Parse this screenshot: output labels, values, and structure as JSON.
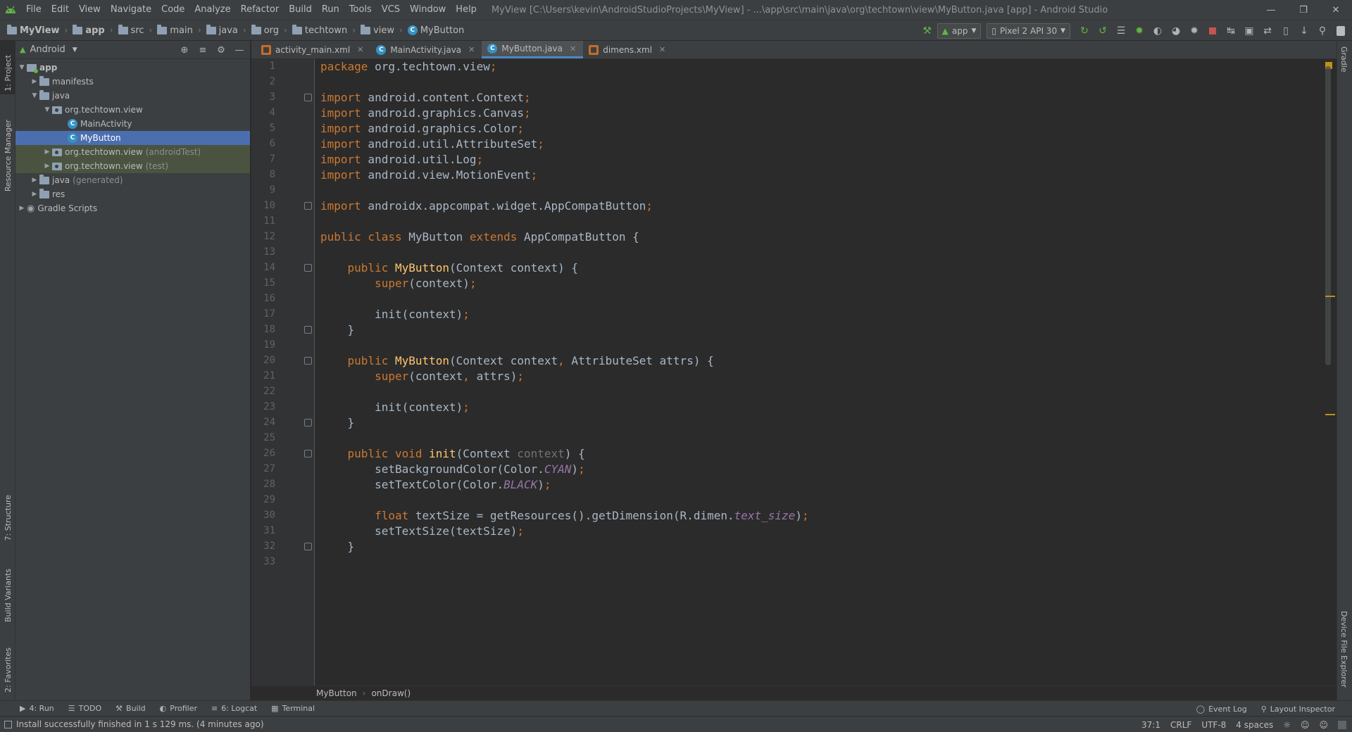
{
  "menubar": {
    "items": [
      "File",
      "Edit",
      "View",
      "Navigate",
      "Code",
      "Analyze",
      "Refactor",
      "Build",
      "Run",
      "Tools",
      "VCS",
      "Window",
      "Help"
    ],
    "window_title": "MyView [C:\\Users\\kevin\\AndroidStudioProjects\\MyView] - ...\\app\\src\\main\\java\\org\\techtown\\view\\MyButton.java [app] - Android Studio"
  },
  "navbar": {
    "crumbs": [
      "MyView",
      "app",
      "src",
      "main",
      "java",
      "org",
      "techtown",
      "view",
      "MyButton"
    ],
    "run_config": "app",
    "device": "Pixel 2 API 30"
  },
  "left_stripe": {
    "project": "1: Project",
    "resource_manager": "Resource Manager",
    "structure": "7: Structure",
    "build_variants": "Build Variants",
    "favorites": "2: Favorites"
  },
  "right_stripe": {
    "gradle": "Gradle",
    "device_file_explorer": "Device File Explorer"
  },
  "project_panel": {
    "view_mode": "Android",
    "tree": [
      {
        "label": "app",
        "suffix": ""
      },
      {
        "label": "manifests",
        "suffix": ""
      },
      {
        "label": "java",
        "suffix": ""
      },
      {
        "label": "org.techtown.view",
        "suffix": ""
      },
      {
        "label": "MainActivity",
        "suffix": ""
      },
      {
        "label": "MyButton",
        "suffix": ""
      },
      {
        "label": "org.techtown.view",
        "suffix": "(androidTest)"
      },
      {
        "label": "org.techtown.view",
        "suffix": "(test)"
      },
      {
        "label": "java",
        "suffix": "(generated)"
      },
      {
        "label": "res",
        "suffix": ""
      },
      {
        "label": "Gradle Scripts",
        "suffix": ""
      }
    ]
  },
  "editor_tabs": [
    {
      "label": "activity_main.xml",
      "type": "xml"
    },
    {
      "label": "MainActivity.java",
      "type": "class"
    },
    {
      "label": "MyButton.java",
      "type": "class",
      "active": true
    },
    {
      "label": "dimens.xml",
      "type": "xml"
    }
  ],
  "code": {
    "line_numbers": [
      "1",
      "2",
      "3",
      "4",
      "5",
      "6",
      "7",
      "8",
      "9",
      "10",
      "11",
      "12",
      "13",
      "14",
      "15",
      "16",
      "17",
      "18",
      "19",
      "20",
      "21",
      "22",
      "23",
      "24",
      "25",
      "26",
      "27",
      "28",
      "29",
      "30",
      "31",
      "32",
      "33"
    ],
    "lines": [
      [
        [
          "kw",
          "package"
        ],
        [
          "t",
          " org.techtown.view"
        ],
        [
          "kw",
          ";"
        ]
      ],
      [],
      [
        [
          "kw",
          "import"
        ],
        [
          "t",
          " android.content.Context"
        ],
        [
          "kw",
          ";"
        ]
      ],
      [
        [
          "kw",
          "import"
        ],
        [
          "t",
          " android.graphics.Canvas"
        ],
        [
          "kw",
          ";"
        ]
      ],
      [
        [
          "kw",
          "import"
        ],
        [
          "t",
          " android.graphics.Color"
        ],
        [
          "kw",
          ";"
        ]
      ],
      [
        [
          "kw",
          "import"
        ],
        [
          "t",
          " android.util.AttributeSet"
        ],
        [
          "kw",
          ";"
        ]
      ],
      [
        [
          "kw",
          "import"
        ],
        [
          "t",
          " android.util.Log"
        ],
        [
          "kw",
          ";"
        ]
      ],
      [
        [
          "kw",
          "import"
        ],
        [
          "t",
          " android.view.MotionEvent"
        ],
        [
          "kw",
          ";"
        ]
      ],
      [],
      [
        [
          "kw",
          "import"
        ],
        [
          "t",
          " androidx.appcompat.widget.AppCompatButton"
        ],
        [
          "kw",
          ";"
        ]
      ],
      [],
      [
        [
          "kw",
          "public class"
        ],
        [
          "t",
          " MyButton "
        ],
        [
          "kw",
          "extends"
        ],
        [
          "t",
          " AppCompatButton {"
        ]
      ],
      [],
      [
        [
          "t",
          "    "
        ],
        [
          "kw",
          "public"
        ],
        [
          "t",
          " "
        ],
        [
          "fn",
          "MyButton"
        ],
        [
          "t",
          "(Context context) {"
        ]
      ],
      [
        [
          "t",
          "        "
        ],
        [
          "kw",
          "super"
        ],
        [
          "t",
          "(context)"
        ],
        [
          "kw",
          ";"
        ]
      ],
      [],
      [
        [
          "t",
          "        init(context)"
        ],
        [
          "kw",
          ";"
        ]
      ],
      [
        [
          "t",
          "    }"
        ]
      ],
      [],
      [
        [
          "t",
          "    "
        ],
        [
          "kw",
          "public"
        ],
        [
          "t",
          " "
        ],
        [
          "fn",
          "MyButton"
        ],
        [
          "t",
          "(Context context"
        ],
        [
          "kw",
          ","
        ],
        [
          "t",
          " AttributeSet attrs) {"
        ]
      ],
      [
        [
          "t",
          "        "
        ],
        [
          "kw",
          "super"
        ],
        [
          "t",
          "(context"
        ],
        [
          "kw",
          ","
        ],
        [
          "t",
          " attrs)"
        ],
        [
          "kw",
          ";"
        ]
      ],
      [],
      [
        [
          "t",
          "        init(context)"
        ],
        [
          "kw",
          ";"
        ]
      ],
      [
        [
          "t",
          "    }"
        ]
      ],
      [],
      [
        [
          "t",
          "    "
        ],
        [
          "kw",
          "public void"
        ],
        [
          "t",
          " "
        ],
        [
          "fn",
          "init"
        ],
        [
          "t",
          "(Context "
        ],
        [
          "unused",
          "context"
        ],
        [
          "t",
          ") {"
        ]
      ],
      [
        [
          "t",
          "        setBackgroundColor(Color."
        ],
        [
          "cst",
          "CYAN"
        ],
        [
          "t",
          ")"
        ],
        [
          "kw",
          ";"
        ]
      ],
      [
        [
          "t",
          "        setTextColor(Color."
        ],
        [
          "cst",
          "BLACK"
        ],
        [
          "t",
          ")"
        ],
        [
          "kw",
          ";"
        ]
      ],
      [],
      [
        [
          "t",
          "        "
        ],
        [
          "kw",
          "float"
        ],
        [
          "t",
          " textSize = getResources().getDimension(R.dimen."
        ],
        [
          "fld",
          "text_size"
        ],
        [
          "t",
          ")"
        ],
        [
          "kw",
          ";"
        ]
      ],
      [
        [
          "t",
          "        setTextSize(textSize)"
        ],
        [
          "kw",
          ";"
        ]
      ],
      [
        [
          "t",
          "    }"
        ]
      ],
      []
    ]
  },
  "editor_breadcrumb": [
    "MyButton",
    "onDraw()"
  ],
  "bottom_toolbar": {
    "left": [
      {
        "icon": "run-icon",
        "label": "4: Run"
      },
      {
        "icon": "todo-icon",
        "label": "TODO"
      },
      {
        "icon": "build-icon",
        "label": "Build"
      },
      {
        "icon": "profiler-icon",
        "label": "Profiler"
      },
      {
        "icon": "logcat-icon",
        "label": "6: Logcat"
      },
      {
        "icon": "terminal-icon",
        "label": "Terminal"
      }
    ],
    "right": [
      {
        "icon": "event-log-icon",
        "label": "Event Log"
      },
      {
        "icon": "layout-inspector-icon",
        "label": "Layout Inspector"
      }
    ]
  },
  "statusbar": {
    "message": "Install successfully finished in 1 s 129 ms. (4 minutes ago)",
    "position": "37:1",
    "line_sep": "CRLF",
    "encoding": "UTF-8",
    "indent": "4 spaces"
  },
  "colors": {
    "keyword": "#cc7832",
    "function": "#ffc66d",
    "constant": "#9876aa",
    "text": "#a9b7c6",
    "selection": "#4b6eaf",
    "class_icon": "#3592c4"
  }
}
